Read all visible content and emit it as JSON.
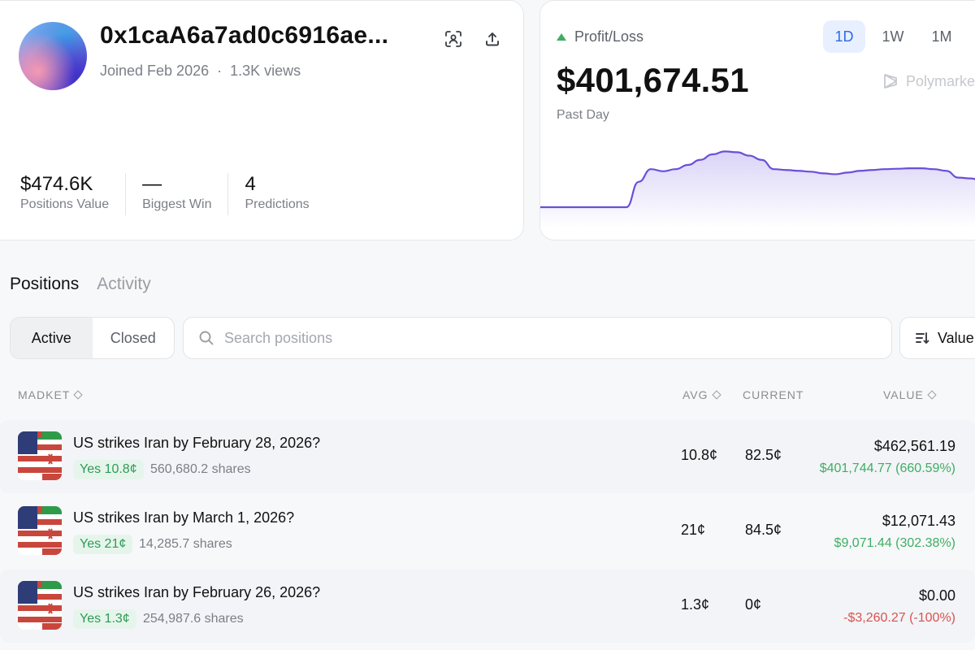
{
  "profile": {
    "address": "0x1caA6a7ad0c6916ae...",
    "joined": "Joined Feb 2026",
    "views": "1.3K views",
    "stats": [
      {
        "value": "$474.6K",
        "label": "Positions Value"
      },
      {
        "value": "—",
        "label": "Biggest Win"
      },
      {
        "value": "4",
        "label": "Predictions"
      }
    ]
  },
  "pnl": {
    "label": "Profit/Loss",
    "value": "$401,674.51",
    "period": "Past Day",
    "ranges": [
      "1D",
      "1W",
      "1M"
    ],
    "active_range": "1D",
    "brand": "Polymarket",
    "colors": {
      "line": "#6b4fd8",
      "up": "#3fae63"
    },
    "series": [
      0,
      0,
      0,
      0,
      0,
      0,
      0,
      0,
      0.6,
      0.9,
      0.85,
      0.9,
      1.0,
      1.12,
      1.25,
      1.32,
      1.3,
      1.22,
      1.12,
      0.9,
      0.88,
      0.86,
      0.84,
      0.8,
      0.78,
      0.82,
      0.86,
      0.88,
      0.9,
      0.91,
      0.92,
      0.92,
      0.9,
      0.86,
      0.7,
      0.68,
      0.62,
      0.5
    ]
  },
  "tabs": [
    "Positions",
    "Activity"
  ],
  "active_tab": "Positions",
  "filter": {
    "active_label": "Active",
    "closed_label": "Closed"
  },
  "search": {
    "placeholder": "Search positions"
  },
  "sort": {
    "label": "Value"
  },
  "table": {
    "headers": {
      "market": "MADKET",
      "avg": "AVG",
      "current": "CURRENT",
      "value": "VALUE"
    },
    "rows": [
      {
        "title": "US strikes Iran by February 28, 2026?",
        "outcome": "Yes 10.8¢",
        "shares": "560,680.2 shares",
        "avg": "10.8¢",
        "current": "82.5¢",
        "value": "$462,561.19",
        "pl": "$401,744.77 (660.59%)",
        "pl_positive": true
      },
      {
        "title": "US strikes Iran by March 1, 2026?",
        "outcome": "Yes 21¢",
        "shares": "14,285.7 shares",
        "avg": "21¢",
        "current": "84.5¢",
        "value": "$12,071.43",
        "pl": "$9,071.44 (302.38%)",
        "pl_positive": true
      },
      {
        "title": "US strikes Iran by February 26, 2026?",
        "outcome": "Yes 1.3¢",
        "shares": "254,987.6 shares",
        "avg": "1.3¢",
        "current": "0¢",
        "value": "$0.00",
        "pl": "-$3,260.27 (-100%)",
        "pl_positive": false
      }
    ]
  },
  "colors": {
    "gain": "#3fae63",
    "loss": "#d9534f",
    "accent": "#2d6be3"
  }
}
